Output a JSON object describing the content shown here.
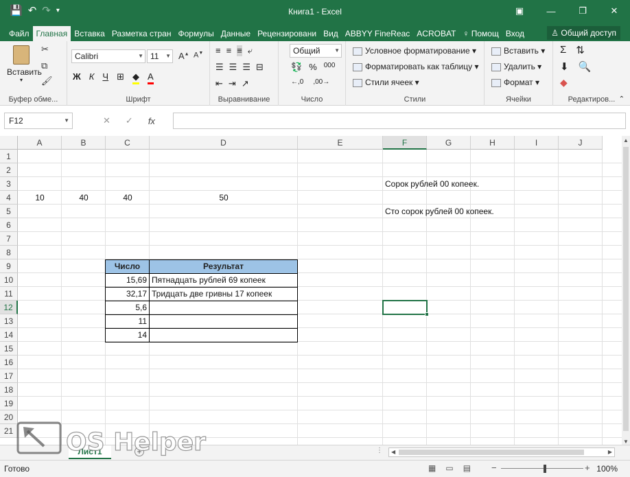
{
  "window": {
    "title": "Книга1 - Excel",
    "qat_save": "💾",
    "qat_undo": "↶",
    "qat_redo": "↷",
    "btn_minimize": "—",
    "btn_restore": "❐",
    "btn_close": "✕"
  },
  "ribbon_tabs": [
    "Файл",
    "Главная",
    "Вставка",
    "Разметка стран",
    "Формулы",
    "Данные",
    "Рецензировани",
    "Вид",
    "ABBYY FineReac",
    "ACROBAT",
    "♀ Помощ",
    "Вход"
  ],
  "share_label": "Общий доступ",
  "groups": {
    "clipboard": {
      "label": "Буфер обме...",
      "paste": "Вставить"
    },
    "font": {
      "label": "Шрифт",
      "font_name": "Calibri",
      "font_size": "11",
      "bold": "Ж",
      "italic": "К",
      "underline": "Ч"
    },
    "alignment": {
      "label": "Выравнивание"
    },
    "number": {
      "label": "Число",
      "format": "Общий",
      "percent": "%",
      "thousands": "000"
    },
    "styles": {
      "label": "Стили",
      "conditional": "Условное форматирование",
      "as_table": "Форматировать как таблицу",
      "cell_styles": "Стили ячеек"
    },
    "cells": {
      "label": "Ячейки",
      "insert": "Вставить",
      "delete": "Удалить",
      "format": "Формат"
    },
    "editing": {
      "label": "Редактиров..."
    }
  },
  "formula_bar": {
    "name_box": "F12",
    "cancel": "✕",
    "enter": "✓",
    "fx": "fx",
    "value": ""
  },
  "columns": [
    "A",
    "B",
    "C",
    "D",
    "E",
    "F",
    "G",
    "H",
    "I",
    "J"
  ],
  "selected_column": "F",
  "rows": [
    "1",
    "2",
    "3",
    "4",
    "5",
    "6",
    "7",
    "8",
    "9",
    "10",
    "11",
    "12",
    "13",
    "14",
    "15",
    "16",
    "17",
    "18",
    "19",
    "20",
    "21"
  ],
  "selected_row": "12",
  "cells": {
    "A4": "10",
    "B4": "40",
    "C4": "40",
    "D4": "50",
    "F3": "Сорок рублей  00 копеек.",
    "F5": "Сто сорок рублей  00 копеек."
  },
  "table": {
    "headers": [
      "Число",
      "Результат"
    ],
    "rows": [
      [
        "15,69",
        "Пятнадцать рублей 69 копеек"
      ],
      [
        "32,17",
        "Тридцать две гривны 17 копеек"
      ],
      [
        "5,6",
        ""
      ],
      [
        "11",
        ""
      ],
      [
        "14",
        ""
      ]
    ]
  },
  "sheet_tab": "Лист1",
  "add_sheet": "+",
  "status": {
    "ready": "Готово",
    "zoom": "100%",
    "zoom_minus": "−",
    "zoom_plus": "+"
  },
  "watermark": "OS Helper"
}
